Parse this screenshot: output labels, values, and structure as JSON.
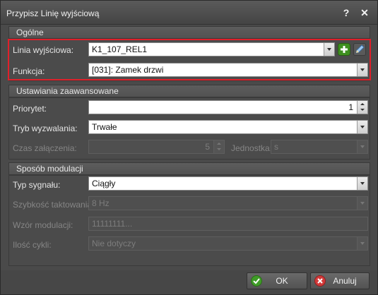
{
  "window": {
    "title": "Przypisz Linię wyjściową",
    "help_glyph": "?",
    "close_glyph": "✕"
  },
  "general": {
    "header": "Ogólne",
    "output_line_label": "Linia wyjściowa:",
    "output_line_value": "K1_107_REL1",
    "function_label": "Funkcja:",
    "function_value": "[031]: Zamek drzwi",
    "highlight_color": "#e0202a"
  },
  "advanced": {
    "header": "Ustawiania zaawansowane",
    "priority_label": "Priorytet:",
    "priority_value": "1",
    "trigger_mode_label": "Tryb wyzwalania:",
    "trigger_mode_value": "Trwałe",
    "on_time_label": "Czas załączenia:",
    "on_time_value": "5",
    "unit_label": "Jednostka:",
    "unit_value": "s"
  },
  "modulation": {
    "header": "Sposób modulacji",
    "signal_type_label": "Typ sygnału:",
    "signal_type_value": "Ciągły",
    "clock_rate_label": "Szybkość taktowania:",
    "clock_rate_value": "8 Hz",
    "pattern_label": "Wzór modulacji:",
    "pattern_value": "11111111...",
    "cycles_label": "Ilość cykli:",
    "cycles_value": "Nie dotyczy"
  },
  "buttons": {
    "ok_label": "OK",
    "cancel_label": "Anuluj"
  },
  "icons": {
    "add": "plus-icon",
    "edit": "pencil-icon",
    "ok": "checkmark-icon",
    "cancel": "cancel-icon",
    "help": "help-icon",
    "close": "close-icon"
  }
}
